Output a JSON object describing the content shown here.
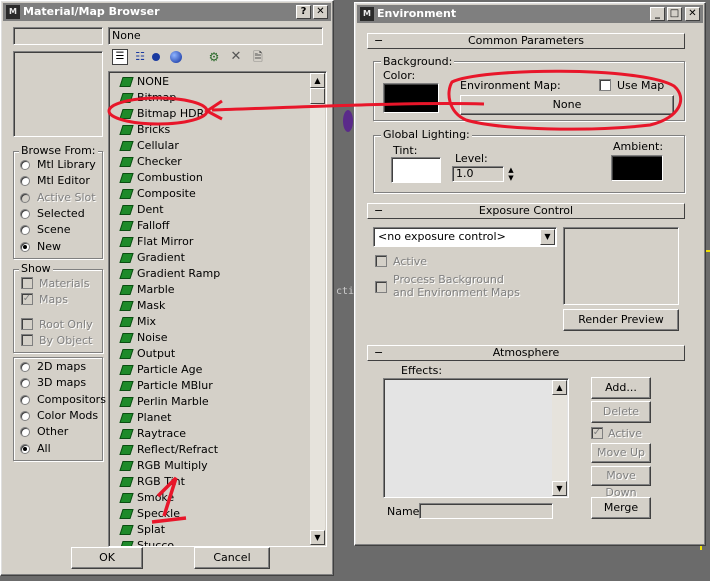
{
  "material_browser": {
    "title": "Material/Map Browser",
    "help_btn": "?",
    "close_btn": "✕",
    "search_value": "",
    "current_map": "None",
    "browse_from": {
      "label": "Browse From:",
      "options": [
        "Mtl Library",
        "Mtl Editor",
        "Active Slot",
        "Selected",
        "Scene",
        "New"
      ],
      "selected": "New"
    },
    "show": {
      "label": "Show",
      "options": [
        "Materials",
        "Maps",
        "Root Only",
        "By Object"
      ]
    },
    "filter": {
      "options": [
        "2D maps",
        "3D maps",
        "Compositors",
        "Color Mods",
        "Other",
        "All"
      ],
      "selected": "All"
    },
    "maps": [
      "NONE",
      "Bitmap",
      "Bitmap HDR",
      "Bricks",
      "Cellular",
      "Checker",
      "Combustion",
      "Composite",
      "Dent",
      "Falloff",
      "Flat Mirror",
      "Gradient",
      "Gradient Ramp",
      "Marble",
      "Mask",
      "Mix",
      "Noise",
      "Output",
      "Particle Age",
      "Particle MBlur",
      "Perlin Marble",
      "Planet",
      "Raytrace",
      "Reflect/Refract",
      "RGB Multiply",
      "RGB Tint",
      "Smoke",
      "Speckle",
      "Splat",
      "Stucco"
    ],
    "ok_label": "OK",
    "cancel_label": "Cancel",
    "annotation_number": "1"
  },
  "environment": {
    "title": "Environment",
    "common": {
      "header": "Common Parameters",
      "background_label": "Background:",
      "color_label": "Color:",
      "env_map_label": "Environment Map:",
      "use_map_label": "Use Map",
      "env_map_value": "None",
      "global_lighting_label": "Global Lighting:",
      "tint_label": "Tint:",
      "level_label": "Level:",
      "level_value": "1.0",
      "ambient_label": "Ambient:"
    },
    "exposure": {
      "header": "Exposure Control",
      "dropdown_value": "<no exposure control>",
      "active_label": "Active",
      "process_bg_label": "Process Background\nand Environment Maps",
      "render_preview_label": "Render Preview"
    },
    "atmosphere": {
      "header": "Atmosphere",
      "effects_label": "Effects:",
      "add_label": "Add...",
      "delete_label": "Delete",
      "active_label": "Active",
      "move_up_label": "Move Up",
      "move_down_label": "Move Down",
      "name_label": "Name:",
      "merge_label": "Merge"
    },
    "minimize_btn": "_",
    "maximize_btn": "□",
    "close_btn": "✕"
  },
  "background_viewport_text": "cti",
  "colors": {
    "title_inactive": "#7f7f7f",
    "panel": "#d4d0c8",
    "annotation_red": "#e8162a",
    "map_icon_green": "#1e8a2a"
  }
}
